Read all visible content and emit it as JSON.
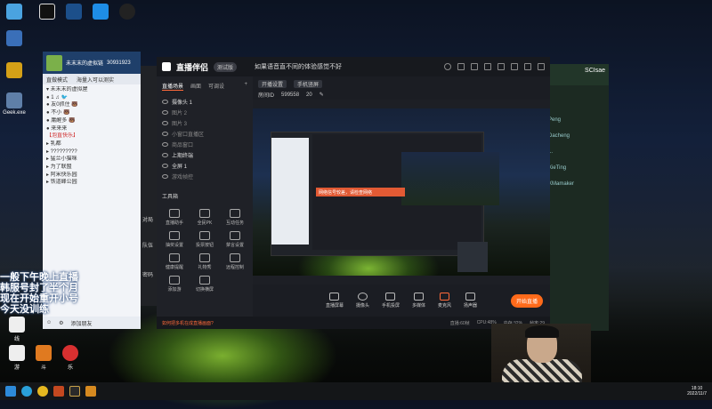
{
  "desktop": {
    "icons": [
      {
        "label": "",
        "icon": "network-icon",
        "color": "#4aa3e0"
      },
      {
        "label": "",
        "icon": "app-icon",
        "color": "#111"
      },
      {
        "label": "",
        "icon": "steam-icon",
        "color": "#1c4f8a"
      },
      {
        "label": "",
        "icon": "gaming-icon",
        "color": "#1e8de6"
      },
      {
        "label": "",
        "icon": "qq-icon",
        "color": "#222"
      },
      {
        "label": "",
        "icon": "computer-icon",
        "color": "#3a6fb8"
      },
      {
        "label": "",
        "icon": "trophy-icon",
        "color": "#d4a017"
      },
      {
        "label": "",
        "icon": "recycle-bin-icon",
        "color": "#5f7fa8"
      },
      {
        "label": "Geek.exe",
        "icon": "geek-icon",
        "color": "#4a7fc0"
      }
    ],
    "bottom_icons": [
      {
        "label": "线",
        "color": "#eee"
      },
      {
        "label": "游",
        "color": "#eee"
      },
      {
        "label": "斗",
        "color": "#e07a20"
      },
      {
        "label": "乐",
        "color": "#d83030"
      }
    ]
  },
  "qq": {
    "nickname": "未末末的虚拟链",
    "id": "30931923",
    "tabs": [
      "直做模式",
      "海量入可以测实"
    ],
    "tree": [
      "▾ 未末末的虚拟屋",
      "  ● 1 ♫ 🐦",
      "  ● 友0抓住 🐻",
      "  ● 不小 🐻",
      "  ● 庸醒多 🐻",
      "  ● 来来来",
      "【泡直快乐】",
      "▸ 乳都",
      "▸ ?????????",
      "▸ 猛兰小猫咪",
      "▸ 为了联盟",
      "▸ 阿米快乐园",
      "▸ 铁道峰公园"
    ],
    "footer_label": "添加朋友"
  },
  "bg_panel": {
    "items": [
      "对局",
      "队伍",
      "密码"
    ]
  },
  "chat": {
    "title": "SCIsae",
    "names": [
      "Peng",
      "Dacheng",
      "...",
      "XieTing",
      "XMamaker"
    ]
  },
  "studio": {
    "logo": "直播伴侣",
    "version": "测试版",
    "title": "如果语音直不同的体验感觉不好",
    "tabs": [
      "直播场景",
      "画面",
      "可调设"
    ],
    "scenes": [
      {
        "label": "摄像头 1",
        "on": true
      },
      {
        "label": "图片 2",
        "on": false
      },
      {
        "label": "图片 3",
        "on": false
      },
      {
        "label": "小窗口直播区",
        "on": false
      },
      {
        "label": "商品窗口",
        "on": false
      },
      {
        "label": "上期终端",
        "on": true
      },
      {
        "label": "全屏 1",
        "on": true
      },
      {
        "label": "游戏帧控",
        "on": false
      }
    ],
    "tools_header": "工具箱",
    "tools": [
      "直播助手",
      "全民PK",
      "互动任务",
      "抽奖设置",
      "投票按钮",
      "禁言设置",
      "健康提醒",
      "礼物秀",
      "远程控制",
      "添加游",
      "切换横屏"
    ],
    "bar": {
      "category": "开播设置",
      "type_label": "手机竖屏",
      "room": "房间ID",
      "viewers": "599558",
      "online": "20"
    },
    "notice": "网络信号较差，请检查网络",
    "controls": [
      "直播屏幕",
      "摄像头",
      "手机投屏",
      "多媒体",
      "麦克风",
      "扬声器"
    ],
    "go_live": "开始直播",
    "footer": [
      "如何把多机在成直播画面?",
      "直播:60帧",
      "CPU:48%",
      "内存:32%",
      "帧率:29"
    ]
  },
  "overlay_text": [
    "一般下午晚上直播",
    "韩服号封了半个月",
    "现在开始重开小号",
    "今天没训练"
  ],
  "taskbar": {
    "time": "18:10",
    "date": "2022/11/7",
    "items": [
      {
        "icon": "windows-start-icon",
        "color": "#2d8ad8"
      },
      {
        "icon": "edge-icon",
        "color": "#2aa0d8"
      },
      {
        "icon": "chrome-icon",
        "color": "#e6b820"
      },
      {
        "icon": "game-icon",
        "color": "#c44820"
      },
      {
        "icon": "league-icon",
        "color": "#2a2a2a"
      },
      {
        "icon": "studio-icon",
        "color": "#d68a20"
      }
    ]
  }
}
